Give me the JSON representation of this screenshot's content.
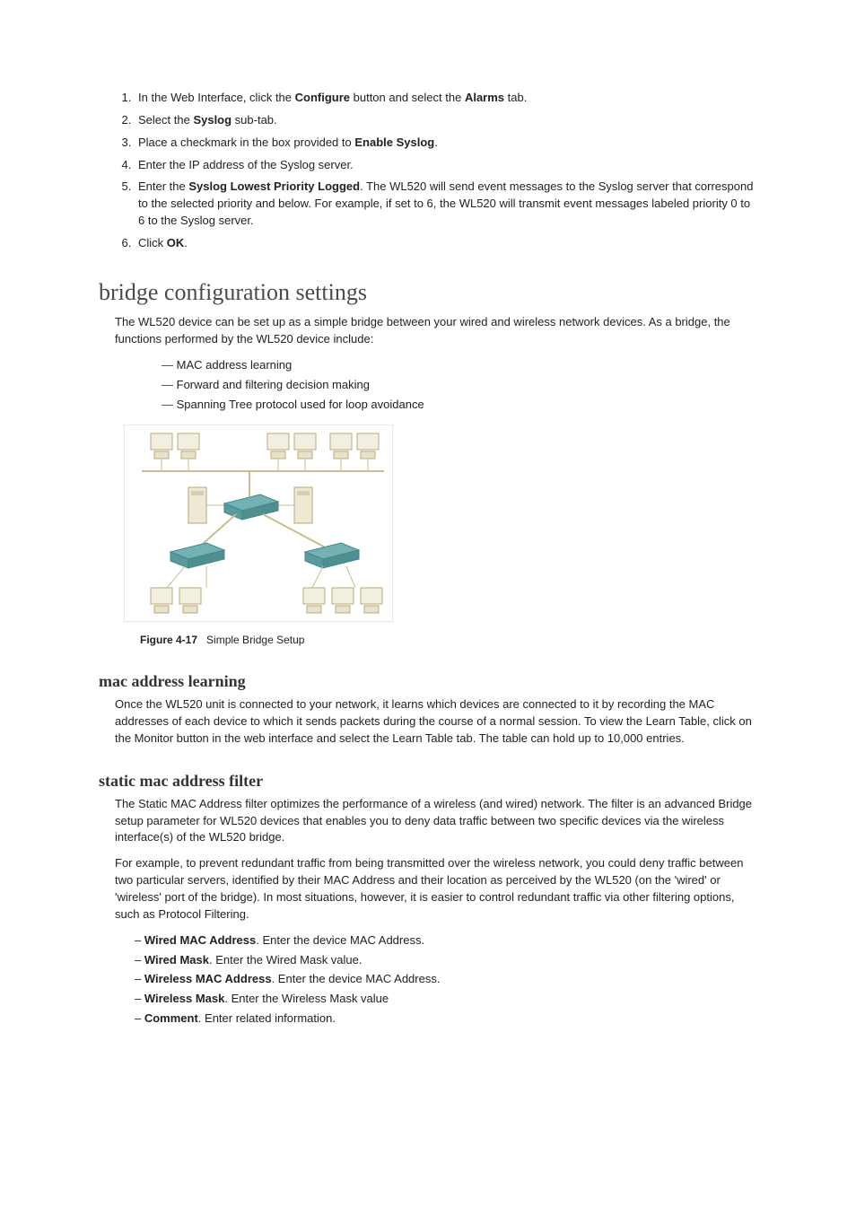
{
  "steps": [
    {
      "prefix": "In the Web Interface, click the ",
      "b1": "Configure",
      "mid": " button and select the ",
      "b2": "Alarms",
      "suffix": " tab."
    },
    {
      "prefix": "Select the ",
      "b1": "Syslog",
      "mid": "",
      "b2": "",
      "suffix": " sub-tab."
    },
    {
      "prefix": "Place a checkmark in the box provided to ",
      "b1": "Enable Syslog",
      "mid": "",
      "b2": "",
      "suffix": "."
    },
    {
      "prefix": "Enter the IP address of the Syslog server.",
      "b1": "",
      "mid": "",
      "b2": "",
      "suffix": ""
    },
    {
      "prefix": "Enter the ",
      "b1": "Syslog Lowest Priority Logged",
      "mid": ". The WL520 will send event messages to the Syslog server that correspond to the selected priority and below. For example, if set to 6, the WL520 will transmit event messages labeled priority 0 to 6 to the Syslog server.",
      "b2": "",
      "suffix": ""
    },
    {
      "prefix": "Click ",
      "b1": "OK",
      "mid": ".",
      "b2": "",
      "suffix": ""
    }
  ],
  "h1_bridge": "bridge configuration settings",
  "bridge_intro": "The WL520 device can be set up as a simple bridge between your wired and wireless network devices. As a bridge, the functions performed by the WL520 device include:",
  "bridge_list": [
    "MAC address learning",
    "Forward and filtering decision making",
    "Spanning Tree protocol used for loop avoidance"
  ],
  "fig_num": "Figure 4-17",
  "fig_title": "Simple Bridge Setup",
  "h2_mac": "mac address learning",
  "mac_para": "Once the WL520 unit is connected to your network, it learns which devices are connected to it by recording the MAC addresses of each device to which it sends packets during the course of a normal session. To view the Learn Table, click on the Monitor button in the web interface and select the Learn Table tab. The table can hold up to 10,000 entries.",
  "h2_static": "static mac address filter",
  "static_p1": "The Static MAC Address filter optimizes the performance of a wireless (and wired) network. The filter is an advanced Bridge setup parameter for WL520 devices that enables you to deny data traffic between two specific devices via the wireless interface(s) of the WL520 bridge.",
  "static_p2": "For example, to prevent redundant traffic from being transmitted over the wireless network, you could deny traffic between two particular servers, identified by their MAC Address and their location as perceived by the WL520 (on the 'wired' or 'wireless' port of the bridge). In most situations, however, it is easier to control redundant traffic via other filtering options, such as Protocol Filtering.",
  "static_items": [
    {
      "b": "Wired MAC Address",
      "t": ". Enter the device MAC Address."
    },
    {
      "b": "Wired Mask",
      "t": ". Enter the Wired Mask value."
    },
    {
      "b": "Wireless MAC Address",
      "t": ". Enter the device MAC Address."
    },
    {
      "b": "Wireless Mask",
      "t": ". Enter the Wireless Mask value"
    },
    {
      "b": "Comment",
      "t": ". Enter related information."
    }
  ]
}
